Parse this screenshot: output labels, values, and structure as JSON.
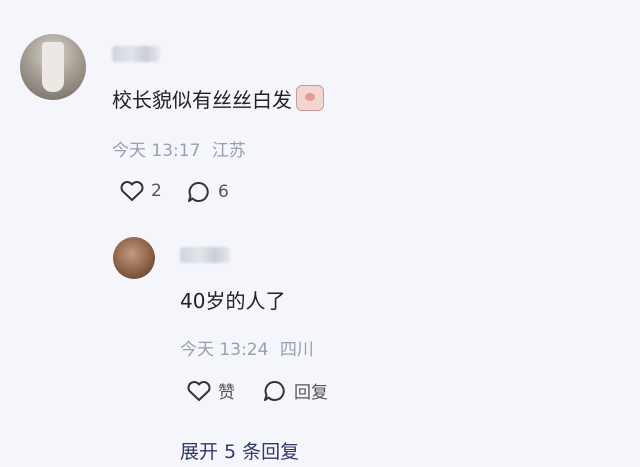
{
  "comment": {
    "text": "校长貌似有丝丝白发",
    "time": "今天 13:17",
    "location": "江苏",
    "likes": "2",
    "replies_count": "6"
  },
  "reply": {
    "text": "40岁的人了",
    "time": "今天 13:24",
    "location": "四川",
    "like_label": "赞",
    "reply_label": "回复"
  },
  "expand_label": "展开 5 条回复",
  "icons": {
    "like": "heart-icon",
    "comment": "comment-bubble-icon",
    "emoji": "pig-emoji-icon"
  }
}
